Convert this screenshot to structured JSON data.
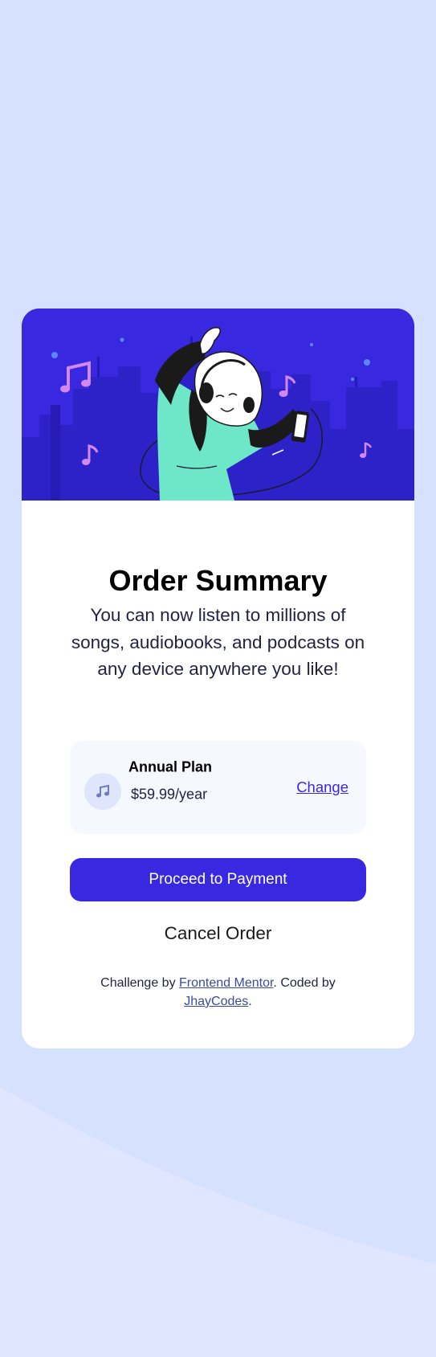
{
  "colors": {
    "page_background": "#d6e1ff",
    "page_wave": "#e0e6ff",
    "card_background": "#ffffff",
    "hero_background": "#3829e0",
    "accent": "#3829e0",
    "plan_box_background": "#f5f8ff"
  },
  "hero": {
    "illustration": "person-dancing-with-headphones-and-phone-over-city-skyline",
    "icons": [
      "music-note-icon",
      "headphones-icon",
      "phone-icon"
    ]
  },
  "card": {
    "title": "Order Summary",
    "description": "You can now listen to millions of songs, audiobooks, and podcasts on any device anywhere you like!"
  },
  "plan": {
    "icon": "music-note-icon",
    "name": "Annual Plan",
    "price": "$59.99/year",
    "change_label": "Change"
  },
  "actions": {
    "proceed_label": "Proceed to Payment",
    "cancel_label": "Cancel Order"
  },
  "attribution": {
    "prefix": "Challenge by ",
    "frontend_mentor_label": "Frontend Mentor",
    "middle": ". Coded by ",
    "author_label": "JhayCodes",
    "suffix": "."
  }
}
